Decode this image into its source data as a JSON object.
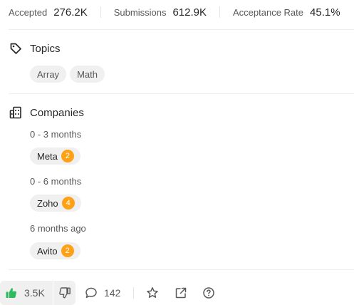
{
  "stats": {
    "accepted_label": "Accepted",
    "accepted_value": "276.2K",
    "submissions_label": "Submissions",
    "submissions_value": "612.9K",
    "acceptance_label": "Acceptance Rate",
    "acceptance_value": "45.1%"
  },
  "topics": {
    "title": "Topics",
    "icon": "tag-icon",
    "tags": [
      "Array",
      "Math"
    ]
  },
  "companies": {
    "title": "Companies",
    "icon": "building-icon",
    "groups": [
      {
        "period": "0 - 3 months",
        "company": "Meta",
        "count": "2"
      },
      {
        "period": "0 - 6 months",
        "company": "Zoho",
        "count": "4"
      },
      {
        "period": "6 months ago",
        "company": "Avito",
        "count": "2"
      }
    ]
  },
  "footer": {
    "upvotes": "3.5K",
    "comments": "142",
    "icons": [
      "thumbs-up-icon",
      "thumbs-down-icon",
      "comment-icon",
      "star-icon",
      "share-icon",
      "help-icon"
    ]
  },
  "colors": {
    "accent": "#ffa116",
    "upvote_green": "#2cbb5d",
    "tag_bg": "#f0f0f0"
  }
}
